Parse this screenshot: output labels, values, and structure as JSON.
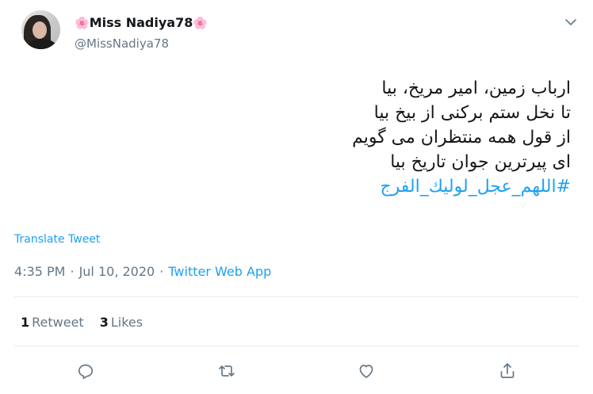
{
  "author": {
    "display_name": "Miss Nadiya78",
    "name_emoji": "🌸",
    "handle": "@MissNadiya78"
  },
  "tweet": {
    "lines": [
      "ارباب زمین، امیر مریخ، بیا",
      "تا نخل ستم برکنی از بیخ بیا",
      "از قول همه منتظران می گویم",
      "ای پیرترین جوان تاریخ بیا"
    ],
    "hashtag": "#اللهم_عجل_لوليك_الفرج"
  },
  "translate_label": "Translate Tweet",
  "meta": {
    "time": "4:35 PM",
    "separator": "·",
    "date": "Jul 10, 2020",
    "source": "Twitter Web App"
  },
  "stats": {
    "retweets": {
      "count": "1",
      "label": "Retweet"
    },
    "likes": {
      "count": "3",
      "label": "Likes"
    }
  },
  "actions": [
    "reply-icon",
    "retweet-icon",
    "like-icon",
    "share-icon"
  ],
  "colors": {
    "accent": "#1da1f2",
    "secondary_text": "#657786",
    "primary_text": "#14171a",
    "divider": "#e6ecf0"
  }
}
